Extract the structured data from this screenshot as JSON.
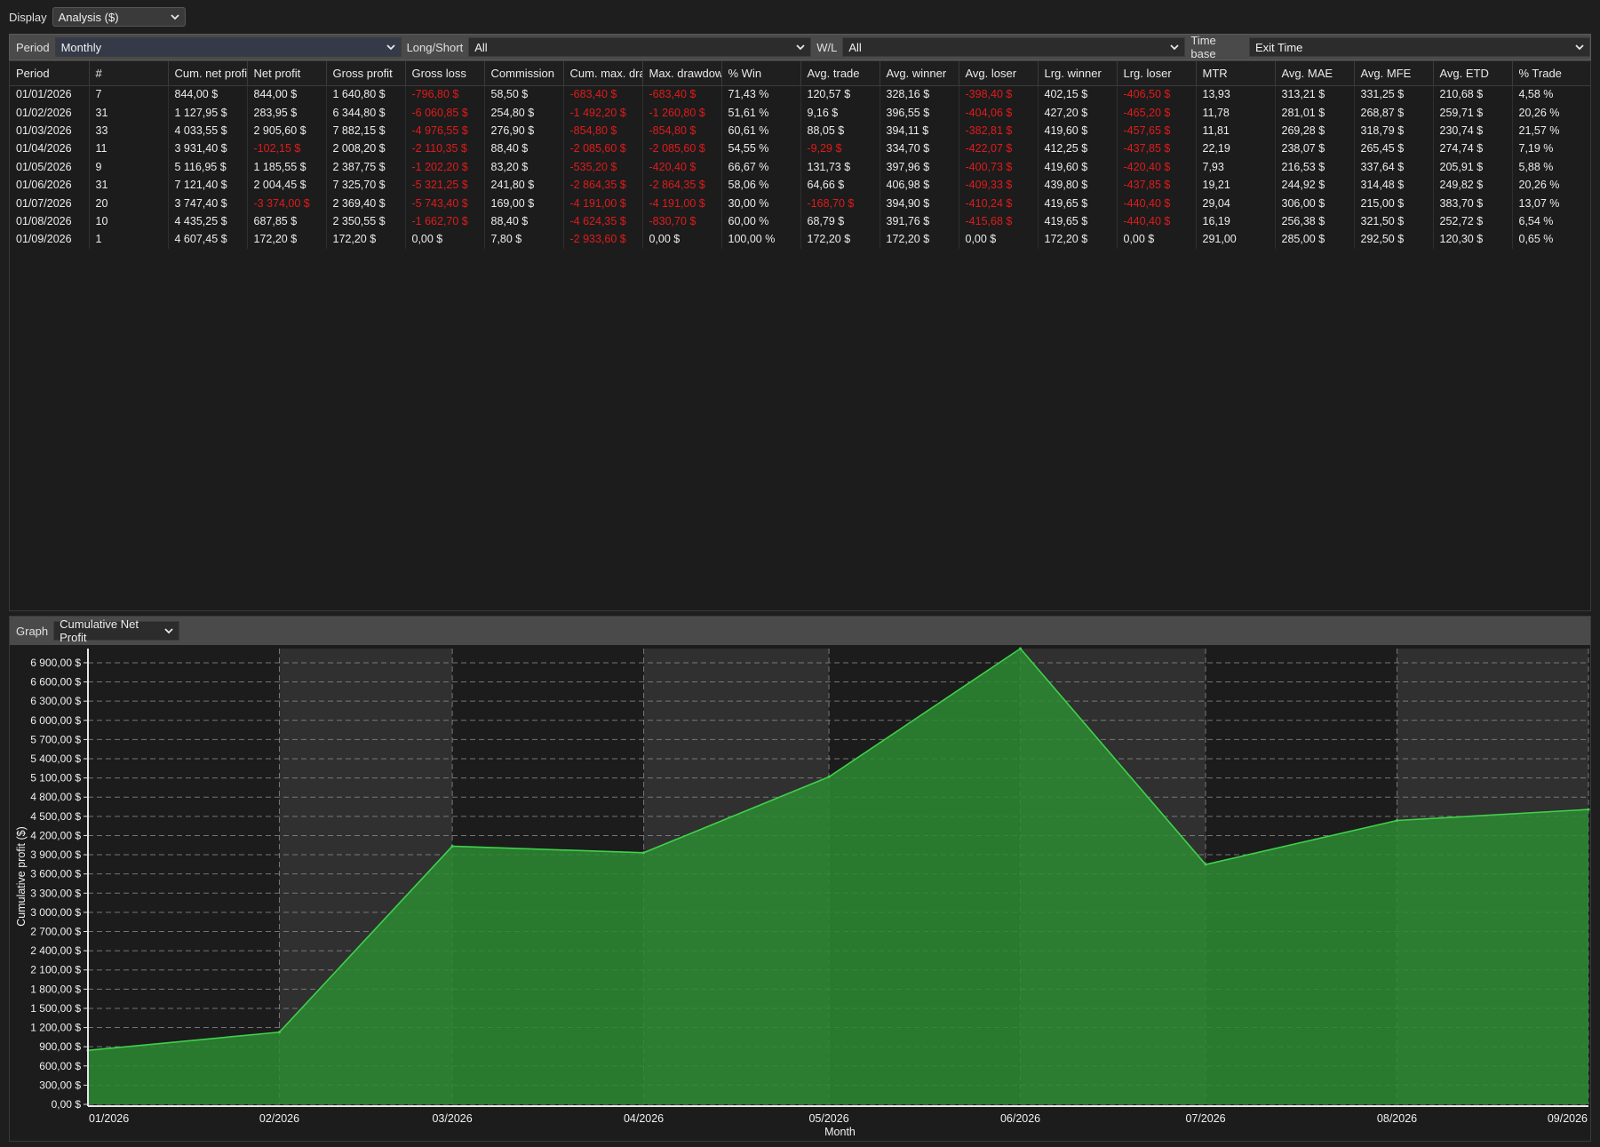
{
  "display": {
    "label": "Display",
    "value": "Analysis ($)"
  },
  "filters": {
    "period_label": "Period",
    "period_value": "Monthly",
    "longshort_label": "Long/Short",
    "longshort_value": "All",
    "wl_label": "W/L",
    "wl_value": "All",
    "timebase_label": "Time base",
    "timebase_value": "Exit Time"
  },
  "table": {
    "columns": [
      "Period",
      "#",
      "Cum. net profi",
      "Net profit",
      "Gross profit",
      "Gross loss",
      "Commission",
      "Cum. max. dra",
      "Max. drawdow",
      "% Win",
      "Avg. trade",
      "Avg. winner",
      "Avg. loser",
      "Lrg. winner",
      "Lrg. loser",
      "MTR",
      "Avg. MAE",
      "Avg. MFE",
      "Avg. ETD",
      "% Trade"
    ],
    "rows": [
      [
        "01/01/2026",
        "7",
        "844,00 $",
        "844,00 $",
        "1 640,80 $",
        "-796,80 $",
        "58,50 $",
        "-683,40 $",
        "-683,40 $",
        "71,43 %",
        "120,57 $",
        "328,16 $",
        "-398,40 $",
        "402,15 $",
        "-406,50 $",
        "13,93",
        "313,21 $",
        "331,25 $",
        "210,68 $",
        "4,58 %"
      ],
      [
        "01/02/2026",
        "31",
        "1 127,95 $",
        "283,95 $",
        "6 344,80 $",
        "-6 060,85 $",
        "254,80 $",
        "-1 492,20 $",
        "-1 260,80 $",
        "51,61 %",
        "9,16 $",
        "396,55 $",
        "-404,06 $",
        "427,20 $",
        "-465,20 $",
        "11,78",
        "281,01 $",
        "268,87 $",
        "259,71 $",
        "20,26 %"
      ],
      [
        "01/03/2026",
        "33",
        "4 033,55 $",
        "2 905,60 $",
        "7 882,15 $",
        "-4 976,55 $",
        "276,90 $",
        "-854,80 $",
        "-854,80 $",
        "60,61 %",
        "88,05 $",
        "394,11 $",
        "-382,81 $",
        "419,60 $",
        "-457,65 $",
        "11,81",
        "269,28 $",
        "318,79 $",
        "230,74 $",
        "21,57 %"
      ],
      [
        "01/04/2026",
        "11",
        "3 931,40 $",
        "-102,15 $",
        "2 008,20 $",
        "-2 110,35 $",
        "88,40 $",
        "-2 085,60 $",
        "-2 085,60 $",
        "54,55 %",
        "-9,29 $",
        "334,70 $",
        "-422,07 $",
        "412,25 $",
        "-437,85 $",
        "22,19",
        "238,07 $",
        "265,45 $",
        "274,74 $",
        "7,19 %"
      ],
      [
        "01/05/2026",
        "9",
        "5 116,95 $",
        "1 185,55 $",
        "2 387,75 $",
        "-1 202,20 $",
        "83,20 $",
        "-535,20 $",
        "-420,40 $",
        "66,67 %",
        "131,73 $",
        "397,96 $",
        "-400,73 $",
        "419,60 $",
        "-420,40 $",
        "7,93",
        "216,53 $",
        "337,64 $",
        "205,91 $",
        "5,88 %"
      ],
      [
        "01/06/2026",
        "31",
        "7 121,40 $",
        "2 004,45 $",
        "7 325,70 $",
        "-5 321,25 $",
        "241,80 $",
        "-2 864,35 $",
        "-2 864,35 $",
        "58,06 %",
        "64,66 $",
        "406,98 $",
        "-409,33 $",
        "439,80 $",
        "-437,85 $",
        "19,21",
        "244,92 $",
        "314,48 $",
        "249,82 $",
        "20,26 %"
      ],
      [
        "01/07/2026",
        "20",
        "3 747,40 $",
        "-3 374,00 $",
        "2 369,40 $",
        "-5 743,40 $",
        "169,00 $",
        "-4 191,00 $",
        "-4 191,00 $",
        "30,00 %",
        "-168,70 $",
        "394,90 $",
        "-410,24 $",
        "419,65 $",
        "-440,40 $",
        "29,04",
        "306,00 $",
        "215,00 $",
        "383,70 $",
        "13,07 %"
      ],
      [
        "01/08/2026",
        "10",
        "4 435,25 $",
        "687,85 $",
        "2 350,55 $",
        "-1 662,70 $",
        "88,40 $",
        "-4 624,35 $",
        "-830,70 $",
        "60,00 %",
        "68,79 $",
        "391,76 $",
        "-415,68 $",
        "419,65 $",
        "-440,40 $",
        "16,19",
        "256,38 $",
        "321,50 $",
        "252,72 $",
        "6,54 %"
      ],
      [
        "01/09/2026",
        "1",
        "4 607,45 $",
        "172,20 $",
        "172,20 $",
        "0,00 $",
        "7,80 $",
        "-2 933,60 $",
        "0,00 $",
        "100,00 %",
        "172,20 $",
        "172,20 $",
        "0,00 $",
        "172,20 $",
        "0,00 $",
        "291,00",
        "285,00 $",
        "292,50 $",
        "120,30 $",
        "0,65 %"
      ]
    ]
  },
  "graph": {
    "label": "Graph",
    "value": "Cumulative Net Profit"
  },
  "colors": {
    "negative": "#e01b1b",
    "fill": "#2b8a32",
    "line": "#3fd14a",
    "band_dark": "#1c1c1c",
    "band_light": "#303030"
  },
  "chart_data": {
    "type": "area",
    "x": [
      "01/2026",
      "02/2026",
      "03/2026",
      "04/2026",
      "05/2026",
      "06/2026",
      "07/2026",
      "08/2026",
      "09/2026"
    ],
    "x_days": [
      0,
      31,
      59,
      90,
      120,
      151,
      181,
      212,
      243
    ],
    "series": [
      {
        "values": [
          844.0,
          1127.95,
          4033.55,
          3931.4,
          5116.95,
          7121.4,
          3747.4,
          4435.25,
          4607.45
        ]
      }
    ],
    "yticks": [
      "0,00 $",
      "300,00 $",
      "600,00 $",
      "900,00 $",
      "1 200,00 $",
      "1 500,00 $",
      "1 800,00 $",
      "2 100,00 $",
      "2 400,00 $",
      "2 700,00 $",
      "3 000,00 $",
      "3 300,00 $",
      "3 600,00 $",
      "3 900,00 $",
      "4 200,00 $",
      "4 500,00 $",
      "4 800,00 $",
      "5 100,00 $",
      "5 400,00 $",
      "5 700,00 $",
      "6 000,00 $",
      "6 300,00 $",
      "6 600,00 $",
      "6 900,00 $"
    ],
    "ytick_values": [
      0,
      300,
      600,
      900,
      1200,
      1500,
      1800,
      2100,
      2400,
      2700,
      3000,
      3300,
      3600,
      3900,
      4200,
      4500,
      4800,
      5100,
      5400,
      5700,
      6000,
      6300,
      6600,
      6900
    ],
    "ylim": [
      0,
      7121.4
    ],
    "xlabel": "Month",
    "ylabel": "Cumulative profit ($)",
    "grid": true
  }
}
